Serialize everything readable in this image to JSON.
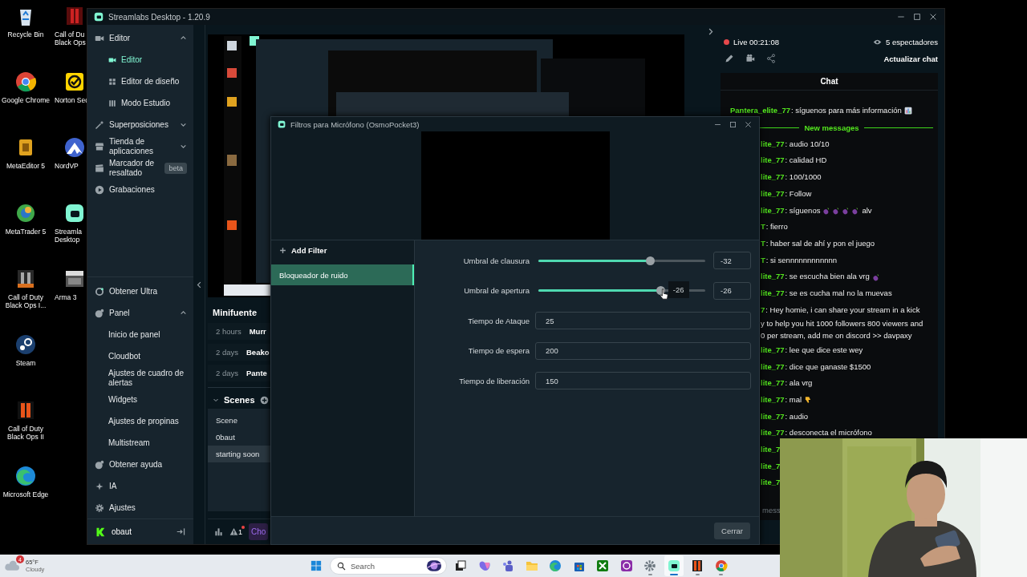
{
  "desktop": {
    "left_icons": [
      {
        "kind": "bin",
        "label": "Recycle Bin"
      },
      {
        "kind": "chrome",
        "label": "Google Chrome"
      },
      {
        "kind": "meta",
        "label": "MetaEditor 5"
      },
      {
        "kind": "trader",
        "label": "MetaTrader 5"
      },
      {
        "kind": "game",
        "label": "Call of Duty\nBlack Ops I..."
      },
      {
        "kind": "steam",
        "label": "Steam"
      },
      {
        "kind": "game2",
        "label": "Call of Duty\nBlack Ops II"
      },
      {
        "kind": "edge",
        "label": "Microsoft Edge"
      }
    ],
    "right_icons": [
      {
        "kind": "game3",
        "label": "Call of Du\nBlack Ops"
      },
      {
        "kind": "norton",
        "label": "Norton Sec"
      },
      {
        "kind": "nord",
        "label": "NordVP"
      },
      {
        "kind": "streamlabs",
        "label": "Streamla\nDesktop"
      },
      {
        "kind": "arma",
        "label": "Arma 3"
      }
    ]
  },
  "app": {
    "title": "Streamlabs Desktop - 1.20.9",
    "sidebar": {
      "top": [
        {
          "kind": "camera",
          "label": "Editor",
          "selected": false,
          "expanded": true,
          "children": [
            {
              "kind": "camera",
              "label": "Editor",
              "selected": true
            },
            {
              "kind": "grid",
              "label": "Editor de diseño",
              "selected": false
            },
            {
              "kind": "columns",
              "label": "Modo Estudio",
              "selected": false
            }
          ]
        },
        {
          "kind": "wand",
          "label": "Superposiciones",
          "selected": false,
          "expanded": false
        },
        {
          "kind": "store",
          "label": "Tienda de aplicaciones",
          "selected": false,
          "expanded": false
        },
        {
          "kind": "clapper",
          "label": "Marcador de resaltado",
          "selected": false,
          "badge": "beta"
        },
        {
          "kind": "play",
          "label": "Grabaciones",
          "selected": false
        }
      ],
      "bottom": [
        {
          "kind": "ultra",
          "label": "Obtener Ultra",
          "selected": false
        },
        {
          "kind": "panel",
          "label": "Panel",
          "selected": false,
          "expanded": true,
          "children": [
            {
              "label": "Inicio de panel",
              "selected": false
            },
            {
              "label": "Cloudbot",
              "selected": false
            },
            {
              "label": "Ajustes de cuadro de alertas",
              "selected": false
            },
            {
              "label": "Widgets",
              "selected": false
            },
            {
              "label": "Ajustes de propinas",
              "selected": false
            },
            {
              "label": "Multistream",
              "selected": false
            }
          ]
        },
        {
          "kind": "help",
          "label": "Obtener ayuda",
          "selected": false
        },
        {
          "kind": "sparkle",
          "label": "IA",
          "selected": false
        },
        {
          "kind": "gear",
          "label": "Ajustes",
          "selected": false
        }
      ],
      "user": {
        "name": "obaut"
      }
    },
    "minifeed": {
      "title": "Minifuente",
      "rows": [
        {
          "time": "2 hours",
          "name": "Murr"
        },
        {
          "time": "2 days",
          "name": "Beako"
        },
        {
          "time": "2 days",
          "name": "Pante"
        }
      ]
    },
    "scenes": {
      "title": "Scenes",
      "expanded": true,
      "items": [
        {
          "label": "Scene",
          "selected": false
        },
        {
          "label": "0baut",
          "selected": false
        },
        {
          "label": "starting soon",
          "selected": true
        }
      ]
    },
    "footer": {
      "alerts": "1",
      "button": "Cho"
    },
    "live": {
      "status": "Live 00:21:08",
      "viewers": "5 espectadores",
      "refresh": "Actualizar chat"
    },
    "chat": {
      "title": "Chat",
      "placeholder": "mess",
      "messages": [
        {
          "kind": "message",
          "clipped": false,
          "user": "Pantera_elite_77",
          "text": ": síguenos para más información",
          "emotes": [
            {
              "kind": "chart"
            }
          ]
        },
        {
          "kind": "divider",
          "text": "New messages"
        },
        {
          "kind": "message",
          "clipped": true,
          "user": "lite_77",
          "text": ": audio 10/10"
        },
        {
          "kind": "message",
          "clipped": true,
          "user": "lite_77",
          "text": ": calidad HD"
        },
        {
          "kind": "message",
          "clipped": true,
          "user": "lite_77",
          "text": ": 100/1000"
        },
        {
          "kind": "message",
          "clipped": true,
          "user": "lite_77",
          "text": ": Follow"
        },
        {
          "kind": "message",
          "clipped": true,
          "user": "lite_77",
          "text": ": síguenos",
          "emotes": [
            {
              "kind": "eggplant"
            },
            {
              "kind": "eggplant"
            },
            {
              "kind": "eggplant"
            },
            {
              "kind": "eggplant"
            }
          ],
          "text_after": "alv"
        },
        {
          "kind": "message",
          "clipped": true,
          "user": "T",
          "text": ": fierro"
        },
        {
          "kind": "message",
          "clipped": true,
          "user": "T",
          "text": ": haber sal de ahí y pon el juego"
        },
        {
          "kind": "message",
          "clipped": true,
          "user": "T",
          "text": ": si sennnnnnnnnnnn"
        },
        {
          "kind": "message",
          "clipped": true,
          "user": "lite_77",
          "text": ": se escucha bien ala vrg",
          "emotes": [
            {
              "kind": "eggplant"
            }
          ]
        },
        {
          "kind": "message",
          "clipped": true,
          "user": "lite_77",
          "text": ": se es cucha mal no la muevas"
        },
        {
          "kind": "message",
          "clipped": true,
          "user": "7",
          "text": ": Hey homie, i can share your stream in a kick"
        },
        {
          "kind": "continuation",
          "clipped": true,
          "text": "y to help you hit 1000 followers 800 viewers and"
        },
        {
          "kind": "continuation",
          "clipped": true,
          "text": "0 per stream, add me on discord >> davpaxy"
        },
        {
          "kind": "message",
          "clipped": true,
          "user": "lite_77",
          "text": ": lee que dice este wey"
        },
        {
          "kind": "message",
          "clipped": true,
          "user": "lite_77",
          "text": ": dice que ganaste $1500"
        },
        {
          "kind": "message",
          "clipped": true,
          "user": "lite_77",
          "text": ": ala vrg"
        },
        {
          "kind": "message",
          "clipped": true,
          "user": "lite_77",
          "text": ": mal",
          "emotes": [
            {
              "kind": "thumbsdown"
            }
          ]
        },
        {
          "kind": "message",
          "clipped": true,
          "user": "lite_77",
          "text": ": audio"
        },
        {
          "kind": "message",
          "clipped": true,
          "user": "lite_77",
          "text": ": desconecta el micrófono"
        },
        {
          "kind": "message",
          "clipped": true,
          "user": "lite_7"
        },
        {
          "kind": "message",
          "clipped": true,
          "user": "lite_7"
        },
        {
          "kind": "message",
          "clipped": true,
          "user": "lite_7"
        }
      ]
    }
  },
  "dialog": {
    "title": "Filtros para Micrófono (OsmoPocket3)",
    "add_filter": "Add Filter",
    "filters": [
      {
        "label": "Bloqueador de ruido",
        "selected": true
      }
    ],
    "settings": [
      {
        "kind": "slider",
        "label": "Umbral de clausura",
        "level": 0.67,
        "value": "-32"
      },
      {
        "kind": "slider",
        "label": "Umbral de apertura",
        "level": 0.73,
        "value": "-26",
        "tooltip": "-26"
      },
      {
        "kind": "number",
        "label": "Tiempo de Ataque",
        "value": "25"
      },
      {
        "kind": "number",
        "label": "Tiempo de espera",
        "value": "200"
      },
      {
        "kind": "number",
        "label": "Tiempo de liberación",
        "value": "150"
      }
    ],
    "close": "Cerrar"
  },
  "taskbar": {
    "weather": {
      "badge": "4",
      "temperature": "65°F",
      "condition": "Cloudy"
    },
    "search": {
      "placeholder": "Search"
    },
    "apps": [
      {
        "kind": "taskview",
        "running": false,
        "selected": false
      },
      {
        "kind": "copilot",
        "running": false,
        "selected": false
      },
      {
        "kind": "teams",
        "running": false,
        "selected": false
      },
      {
        "kind": "folder",
        "running": false,
        "selected": false
      },
      {
        "kind": "edge",
        "running": false,
        "selected": false
      },
      {
        "kind": "store",
        "running": false,
        "selected": false
      },
      {
        "kind": "xbox",
        "running": false,
        "selected": false
      },
      {
        "kind": "purple",
        "running": false,
        "selected": false
      },
      {
        "kind": "settings",
        "running": true,
        "selected": false
      },
      {
        "kind": "streamlabs",
        "running": true,
        "selected": true
      },
      {
        "kind": "game2",
        "running": true,
        "selected": false
      },
      {
        "kind": "chrome",
        "running": true,
        "selected": false
      }
    ]
  }
}
